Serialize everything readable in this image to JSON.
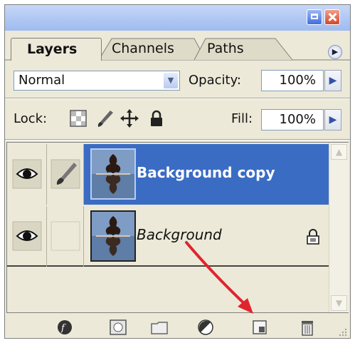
{
  "window": {
    "minimize_icon": "minimize-icon",
    "close_icon": "close-icon"
  },
  "tabs": [
    {
      "label": "Layers",
      "active": true
    },
    {
      "label": "Channels",
      "active": false
    },
    {
      "label": "Paths",
      "active": false
    }
  ],
  "panel_menu_icon": "panel-menu-arrow-icon",
  "blend": {
    "value": "Normal",
    "opacity_label": "Opacity:",
    "opacity_value": "100%"
  },
  "lock": {
    "label": "Lock:",
    "icons": [
      "lock-transparency-icon",
      "lock-image-pixels-icon",
      "lock-position-icon",
      "lock-all-icon"
    ],
    "fill_label": "Fill:",
    "fill_value": "100%"
  },
  "layers": [
    {
      "name": "Background copy",
      "visible": true,
      "brush_linked": true,
      "selected": true,
      "locked": false
    },
    {
      "name": "Background",
      "visible": true,
      "brush_linked": false,
      "selected": false,
      "locked": true
    }
  ],
  "toolbar_icons": [
    "layer-style-icon",
    "layer-mask-icon",
    "new-group-icon",
    "adjustment-layer-icon",
    "new-layer-icon",
    "delete-layer-icon"
  ],
  "colors": {
    "selection": "#3a6cc4",
    "panel_bg": "#ece9d8",
    "annotation_arrow": "#e0242e"
  }
}
